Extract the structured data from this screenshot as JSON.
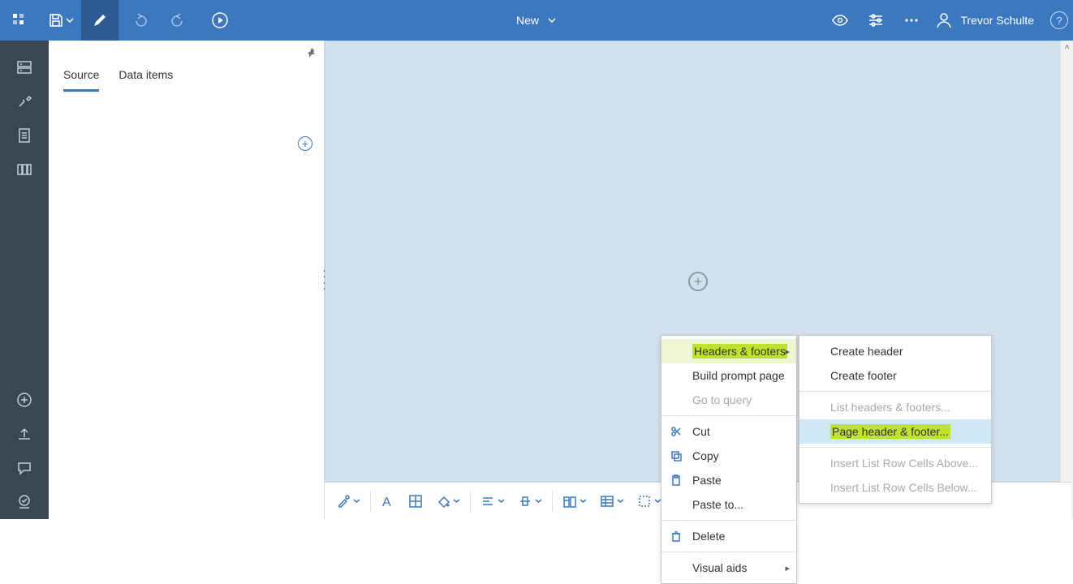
{
  "topbar": {
    "title": "New",
    "user_name": "Trevor Schulte"
  },
  "sidepanel": {
    "tabs": {
      "source": "Source",
      "data_items": "Data items"
    }
  },
  "context_menu_1": {
    "headers_footers": "Headers & footers",
    "build_prompt": "Build prompt page",
    "go_to_query": "Go to query",
    "cut": "Cut",
    "copy": "Copy",
    "paste": "Paste",
    "paste_to": "Paste to...",
    "delete": "Delete",
    "visual_aids": "Visual aids"
  },
  "context_menu_2": {
    "create_header": "Create header",
    "create_footer": "Create footer",
    "list_hf": "List headers & footers...",
    "page_hf": "Page header & footer...",
    "insert_above": "Insert List Row Cells Above...",
    "insert_below": "Insert List Row Cells Below..."
  }
}
